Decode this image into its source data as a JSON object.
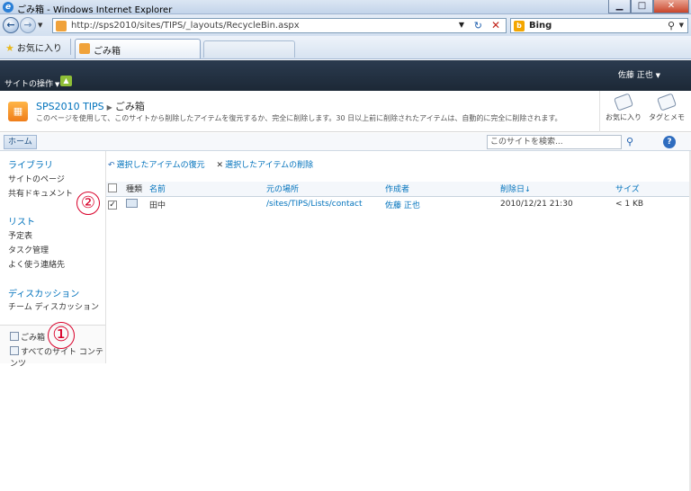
{
  "window": {
    "title": "ごみ箱 - Windows Internet Explorer",
    "min_label": "▁",
    "max_label": "□",
    "close_label": "✕"
  },
  "address": {
    "url": "http://sps2010/sites/TIPS/_layouts/RecycleBin.aspx",
    "search_engine": "Bing"
  },
  "favorites": {
    "button_label": "お気に入り",
    "tab_label": "ごみ箱"
  },
  "sp": {
    "site_actions": "サイトの操作",
    "user_name": "佐藤 正也",
    "site_name": "SPS2010 TIPS",
    "page_title": "ごみ箱",
    "page_description": "このページを使用して、このサイトから削除したアイテムを復元するか、完全に削除します。30 日以上前に削除されたアイテムは、自動的に完全に削除されます。",
    "tag_fav": "お気に入り",
    "tag_notes": "タグとメモ",
    "home_tab": "ホーム",
    "search_placeholder": "このサイトを検索..."
  },
  "leftnav": {
    "libraries_head": "ライブラリ",
    "libraries": [
      "サイトのページ",
      "共有ドキュメント"
    ],
    "lists_head": "リスト",
    "lists": [
      "予定表",
      "タスク管理",
      "よく使う連絡先"
    ],
    "discussions_head": "ディスカッション",
    "discussions": [
      "チーム ディスカッション"
    ],
    "recycle_bin": "ごみ箱",
    "all_content": "すべてのサイト コンテンツ"
  },
  "annotations": {
    "one": "①",
    "two": "②"
  },
  "toolbar": {
    "restore_label": "選択したアイテムの復元",
    "delete_label": "選択したアイテムの削除"
  },
  "table": {
    "headers": {
      "type": "種類",
      "name": "名前",
      "location": "元の場所",
      "author": "作成者",
      "deleted": "削除日",
      "size": "サイズ"
    },
    "rows": [
      {
        "name": "田中",
        "location": "/sites/TIPS/Lists/contact",
        "author": "佐藤 正也",
        "deleted": "2010/12/21 21:30",
        "size": "< 1 KB",
        "checked": "✓"
      }
    ]
  }
}
